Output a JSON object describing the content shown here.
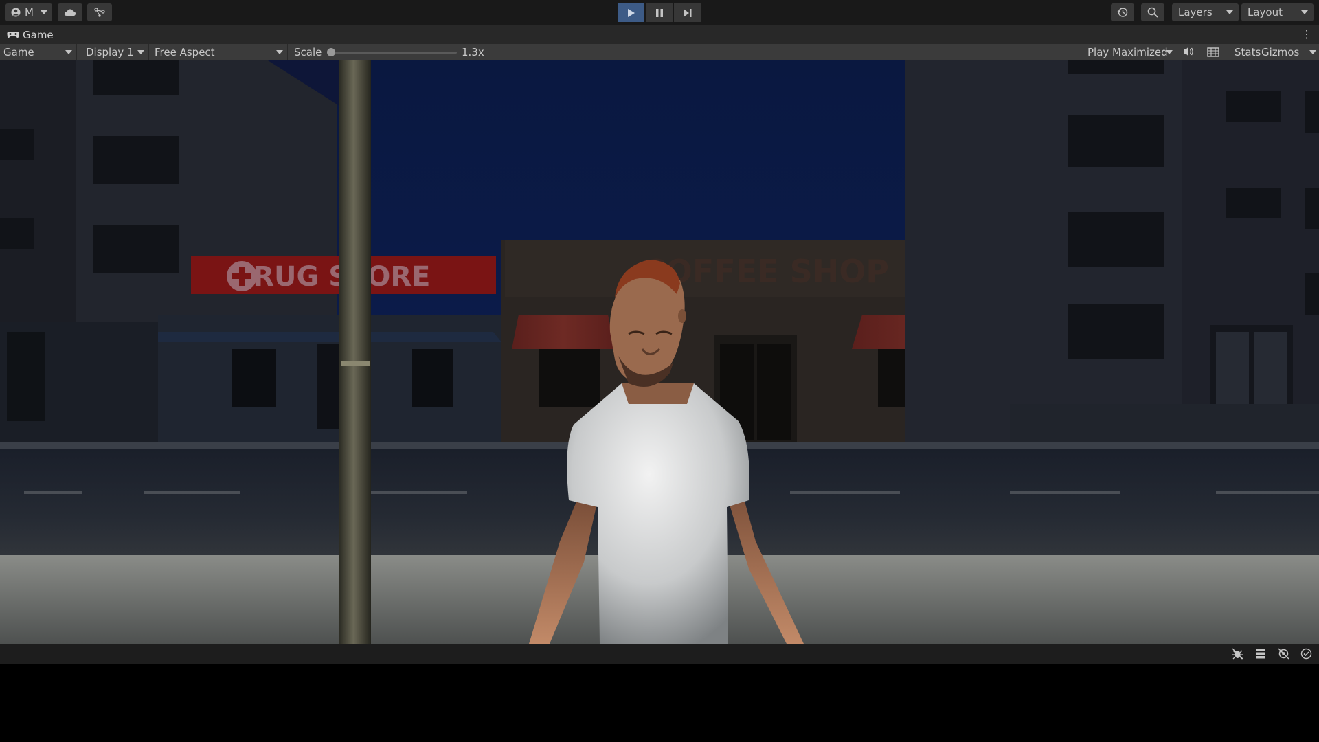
{
  "toolbar": {
    "account_initial": "M",
    "layers_label": "Layers",
    "layout_label": "Layout",
    "icons": [
      "account-icon",
      "cloud-icon",
      "collab-icon",
      "play-icon",
      "pause-icon",
      "step-icon",
      "history-icon",
      "search-icon"
    ],
    "play_active_color": "#3d5b86"
  },
  "tab": {
    "title": "Game",
    "icon": "gamepad-icon",
    "menu": "⋮"
  },
  "game_toolbar": {
    "view_mode": "Game",
    "display": "Display 1",
    "aspect": "Free Aspect",
    "scale_label": "Scale",
    "scale_value": "1.3x",
    "play_mode": "Play Maximized",
    "stats_label": "Stats",
    "gizmos_label": "Gizmos"
  },
  "scene": {
    "drugstore_sign": "DRUG STORE",
    "coffee_sign": "COFFEE SHOP",
    "sign_red": "#b01818",
    "sky_color": "#0b1a44"
  },
  "statusbar": {
    "icons": [
      "debug-icon",
      "layers-stack-icon",
      "visibility-off-icon",
      "checkmark-icon"
    ]
  }
}
